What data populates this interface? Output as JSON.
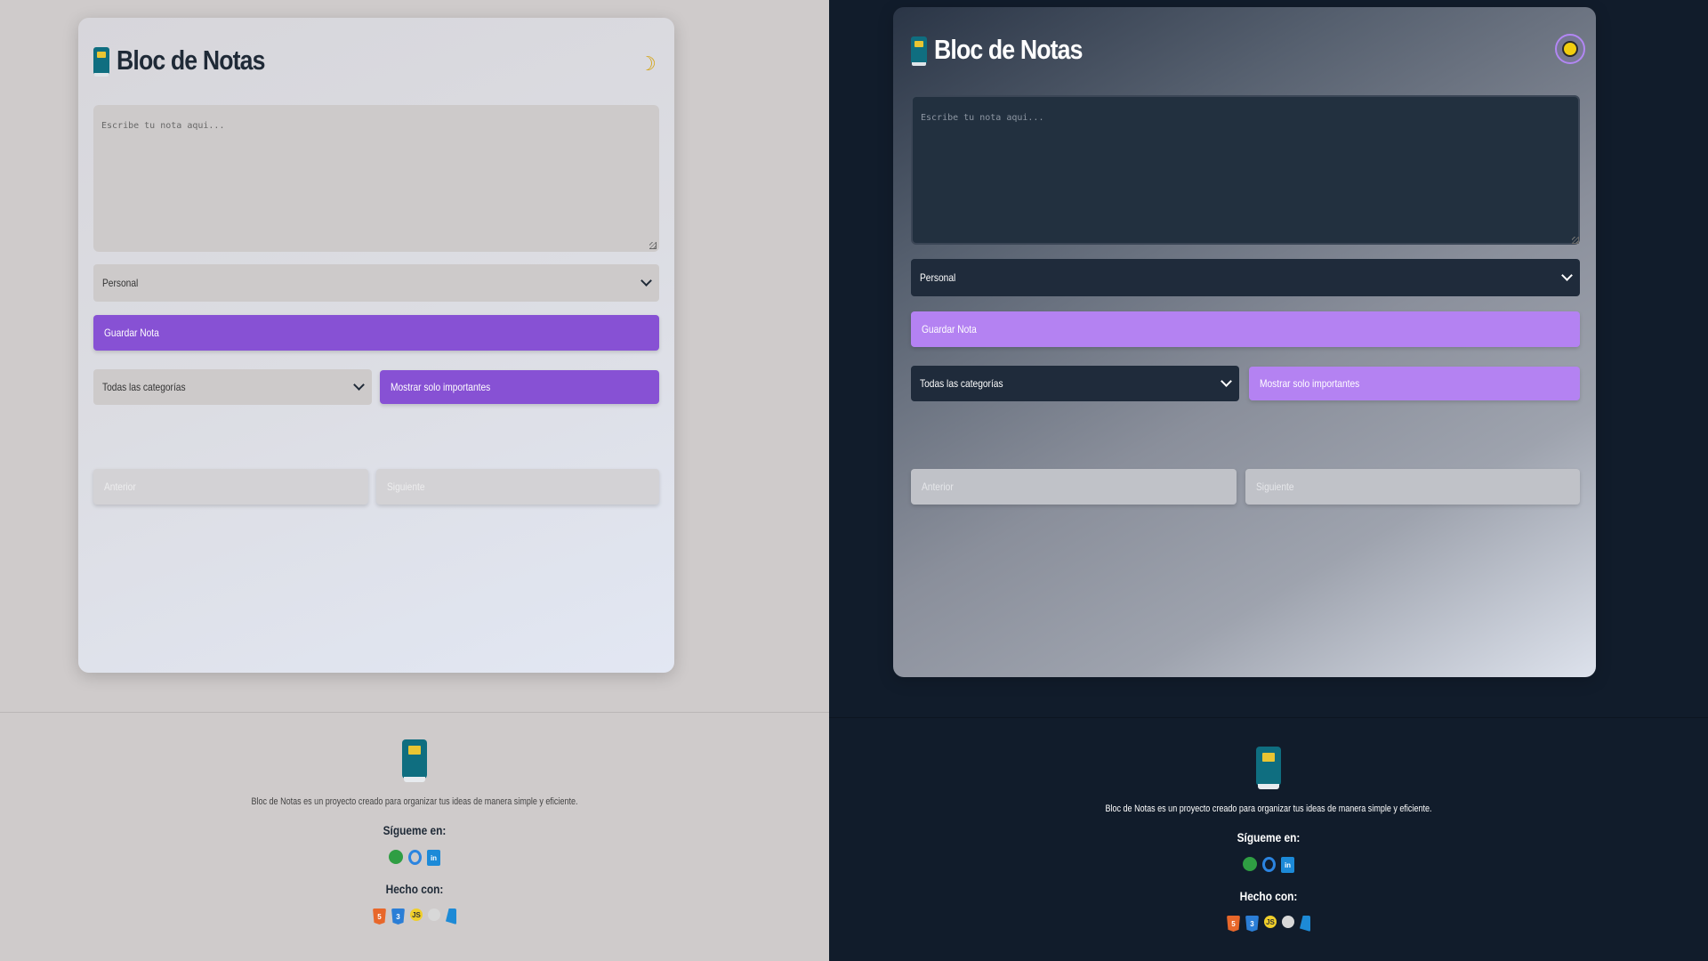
{
  "app": {
    "title": "Bloc de Notas",
    "note_placeholder": "Escribe tu nota aqui...",
    "category_value": "Personal",
    "save_label": "Guardar Nota",
    "filter_value": "Todas las categorías",
    "important_label": "Mostrar solo importantes",
    "prev_label": "Anterior",
    "next_label": "Siguiente"
  },
  "footer": {
    "description": "Bloc de Notas es un proyecto creado para organizar tus ideas de manera simple y eficiente.",
    "follow_heading": "Sígueme en:",
    "made_heading": "Hecho con:",
    "social_icons": [
      "whatsapp-icon",
      "github-icon",
      "linkedin-icon"
    ],
    "tech_icons": [
      "html5-icon",
      "css3-icon",
      "javascript-icon",
      "github-icon",
      "vscode-icon"
    ]
  },
  "themes": {
    "light": {
      "background": "#cfcbcb",
      "accent": "#8751d4",
      "toggle_icon": "moon-icon"
    },
    "dark": {
      "background": "#111c2b",
      "accent": "#b482f2",
      "toggle_icon": "sun-icon"
    }
  }
}
